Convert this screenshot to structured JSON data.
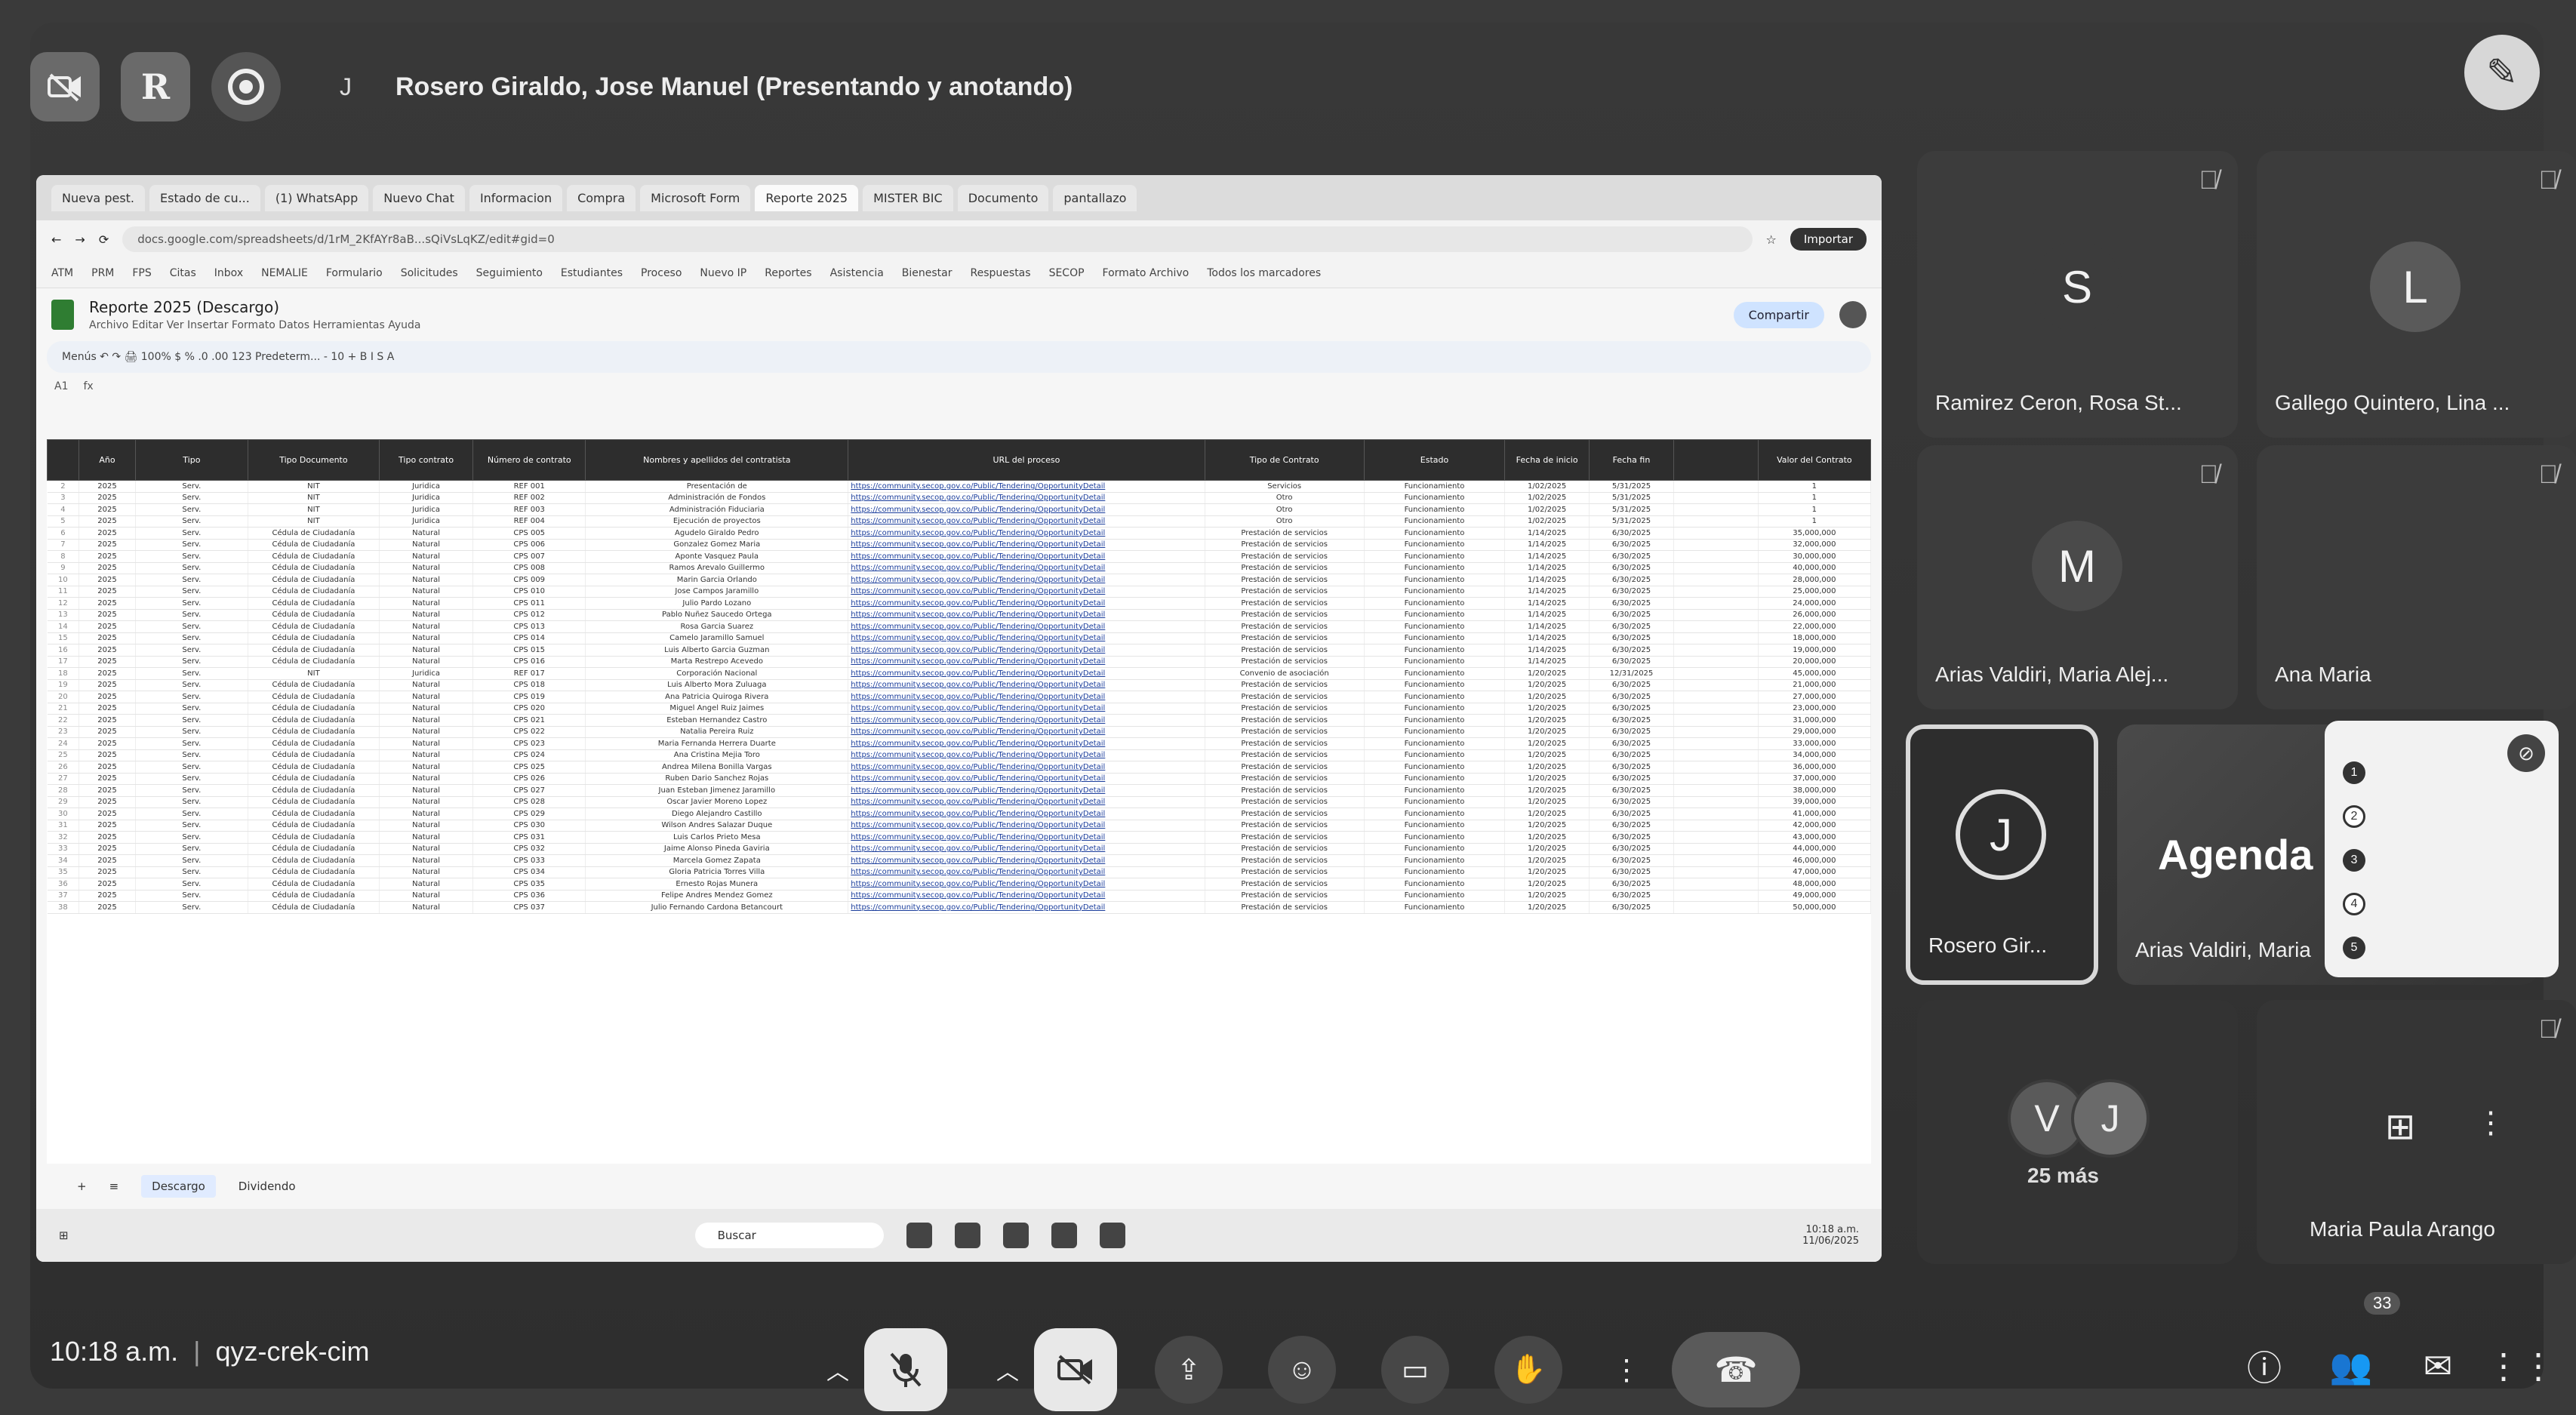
{
  "topbar": {
    "btn_noVideo_icon": "camera-off-icon",
    "btn_book_icon": "presentation-icon",
    "btn_record_icon": "record-icon",
    "presenter_initial": "J",
    "presenter_label": "Rosero Giraldo, Jose Manuel (Presentando y anotando)",
    "annotate_icon": "pencil-icon"
  },
  "screen": {
    "tabs": [
      "Nueva pest.",
      "Estado de cu...",
      "(1) WhatsApp",
      "Nuevo Chat",
      "Informacion",
      "Compra",
      "Microsoft Form",
      "Reporte 2025",
      "MISTER BIC",
      "Documento",
      "pantallazo"
    ],
    "url": "docs.google.com/spreadsheets/d/1rM_2KfAYr8aB...sQiVsLqKZ/edit#gid=0",
    "import_label": "Importar",
    "bookmarks": [
      "ATM",
      "PRM",
      "FPS",
      "Citas",
      "Inbox",
      "NEMALIE",
      "Formulario",
      "Solicitudes",
      "Seguimiento",
      "Estudiantes",
      "Proceso",
      "Nuevo IP",
      "Reportes",
      "Asistencia",
      "Bienestar",
      "Respuestas",
      "SECOP",
      "Formato Archivo",
      "Todos los marcadores"
    ],
    "doc_title": "Reporte 2025 (Descargo)",
    "doc_menu": "Archivo   Editar   Ver   Insertar   Formato   Datos   Herramientas   Ayuda",
    "share_label": "Compartir",
    "toolbar_text": "Menús   ↶  ↷  🖨  100%  $  %  .0  .00  123  Predeterm...  -  10  +  B  I  S  A",
    "cell_ref": "A1",
    "headers": [
      "Año",
      "Tipo",
      "Tipo Documento",
      "Tipo contrato",
      "Número de contrato",
      "Nombres y apellidos del contratista",
      "URL del proceso",
      "Tipo de Contrato",
      "Estado",
      "Fecha de inicio",
      "Fecha fin",
      "",
      "Valor del Contrato"
    ],
    "rows": [
      [
        "2025",
        "Serv.",
        "NIT",
        "Juridica",
        "REF 001",
        "Presentación de",
        "https://community.secop.gov.co/Public/Tendering/OpportunityDetail",
        "Servicios",
        "Funcionamiento",
        "1/02/2025",
        "5/31/2025",
        "",
        "1"
      ],
      [
        "2025",
        "Serv.",
        "NIT",
        "Juridica",
        "REF 002",
        "Administración de Fondos",
        "https://community.secop.gov.co/Public/Tendering/OpportunityDetail",
        "Otro",
        "Funcionamiento",
        "1/02/2025",
        "5/31/2025",
        "",
        "1"
      ],
      [
        "2025",
        "Serv.",
        "NIT",
        "Juridica",
        "REF 003",
        "Administración Fiduciaria",
        "https://community.secop.gov.co/Public/Tendering/OpportunityDetail",
        "Otro",
        "Funcionamiento",
        "1/02/2025",
        "5/31/2025",
        "",
        "1"
      ],
      [
        "2025",
        "Serv.",
        "NIT",
        "Juridica",
        "REF 004",
        "Ejecución de proyectos",
        "https://community.secop.gov.co/Public/Tendering/OpportunityDetail",
        "Otro",
        "Funcionamiento",
        "1/02/2025",
        "5/31/2025",
        "",
        "1"
      ],
      [
        "2025",
        "Serv.",
        "Cédula de Ciudadanía",
        "Natural",
        "CPS 005",
        "Agudelo Giraldo Pedro",
        "https://community.secop.gov.co/Public/Tendering/OpportunityDetail",
        "Prestación de servicios",
        "Funcionamiento",
        "1/14/2025",
        "6/30/2025",
        "",
        "35,000,000"
      ],
      [
        "2025",
        "Serv.",
        "Cédula de Ciudadanía",
        "Natural",
        "CPS 006",
        "Gonzalez Gomez Maria",
        "https://community.secop.gov.co/Public/Tendering/OpportunityDetail",
        "Prestación de servicios",
        "Funcionamiento",
        "1/14/2025",
        "6/30/2025",
        "",
        "32,000,000"
      ],
      [
        "2025",
        "Serv.",
        "Cédula de Ciudadanía",
        "Natural",
        "CPS 007",
        "Aponte Vasquez Paula",
        "https://community.secop.gov.co/Public/Tendering/OpportunityDetail",
        "Prestación de servicios",
        "Funcionamiento",
        "1/14/2025",
        "6/30/2025",
        "",
        "30,000,000"
      ],
      [
        "2025",
        "Serv.",
        "Cédula de Ciudadanía",
        "Natural",
        "CPS 008",
        "Ramos Arevalo Guillermo",
        "https://community.secop.gov.co/Public/Tendering/OpportunityDetail",
        "Prestación de servicios",
        "Funcionamiento",
        "1/14/2025",
        "6/30/2025",
        "",
        "40,000,000"
      ],
      [
        "2025",
        "Serv.",
        "Cédula de Ciudadanía",
        "Natural",
        "CPS 009",
        "Marin Garcia Orlando",
        "https://community.secop.gov.co/Public/Tendering/OpportunityDetail",
        "Prestación de servicios",
        "Funcionamiento",
        "1/14/2025",
        "6/30/2025",
        "",
        "28,000,000"
      ],
      [
        "2025",
        "Serv.",
        "Cédula de Ciudadanía",
        "Natural",
        "CPS 010",
        "Jose Campos Jaramillo",
        "https://community.secop.gov.co/Public/Tendering/OpportunityDetail",
        "Prestación de servicios",
        "Funcionamiento",
        "1/14/2025",
        "6/30/2025",
        "",
        "25,000,000"
      ],
      [
        "2025",
        "Serv.",
        "Cédula de Ciudadanía",
        "Natural",
        "CPS 011",
        "Julio Pardo Lozano",
        "https://community.secop.gov.co/Public/Tendering/OpportunityDetail",
        "Prestación de servicios",
        "Funcionamiento",
        "1/14/2025",
        "6/30/2025",
        "",
        "24,000,000"
      ],
      [
        "2025",
        "Serv.",
        "Cédula de Ciudadanía",
        "Natural",
        "CPS 012",
        "Pablo Nuñez Saucedo Ortega",
        "https://community.secop.gov.co/Public/Tendering/OpportunityDetail",
        "Prestación de servicios",
        "Funcionamiento",
        "1/14/2025",
        "6/30/2025",
        "",
        "26,000,000"
      ],
      [
        "2025",
        "Serv.",
        "Cédula de Ciudadanía",
        "Natural",
        "CPS 013",
        "Rosa Garcia Suarez",
        "https://community.secop.gov.co/Public/Tendering/OpportunityDetail",
        "Prestación de servicios",
        "Funcionamiento",
        "1/14/2025",
        "6/30/2025",
        "",
        "22,000,000"
      ],
      [
        "2025",
        "Serv.",
        "Cédula de Ciudadanía",
        "Natural",
        "CPS 014",
        "Camelo Jaramillo Samuel",
        "https://community.secop.gov.co/Public/Tendering/OpportunityDetail",
        "Prestación de servicios",
        "Funcionamiento",
        "1/14/2025",
        "6/30/2025",
        "",
        "18,000,000"
      ],
      [
        "2025",
        "Serv.",
        "Cédula de Ciudadanía",
        "Natural",
        "CPS 015",
        "Luis Alberto Garcia Guzman",
        "https://community.secop.gov.co/Public/Tendering/OpportunityDetail",
        "Prestación de servicios",
        "Funcionamiento",
        "1/14/2025",
        "6/30/2025",
        "",
        "19,000,000"
      ],
      [
        "2025",
        "Serv.",
        "Cédula de Ciudadanía",
        "Natural",
        "CPS 016",
        "Marta Restrepo Acevedo",
        "https://community.secop.gov.co/Public/Tendering/OpportunityDetail",
        "Prestación de servicios",
        "Funcionamiento",
        "1/14/2025",
        "6/30/2025",
        "",
        "20,000,000"
      ],
      [
        "2025",
        "Serv.",
        "NIT",
        "Juridica",
        "REF 017",
        "Corporación Nacional",
        "https://community.secop.gov.co/Public/Tendering/OpportunityDetail",
        "Convenio de asociación",
        "Funcionamiento",
        "1/20/2025",
        "12/31/2025",
        "",
        "45,000,000"
      ],
      [
        "2025",
        "Serv.",
        "Cédula de Ciudadanía",
        "Natural",
        "CPS 018",
        "Luis Alberto Mora Zuluaga",
        "https://community.secop.gov.co/Public/Tendering/OpportunityDetail",
        "Prestación de servicios",
        "Funcionamiento",
        "1/20/2025",
        "6/30/2025",
        "",
        "21,000,000"
      ],
      [
        "2025",
        "Serv.",
        "Cédula de Ciudadanía",
        "Natural",
        "CPS 019",
        "Ana Patricia Quiroga Rivera",
        "https://community.secop.gov.co/Public/Tendering/OpportunityDetail",
        "Prestación de servicios",
        "Funcionamiento",
        "1/20/2025",
        "6/30/2025",
        "",
        "27,000,000"
      ],
      [
        "2025",
        "Serv.",
        "Cédula de Ciudadanía",
        "Natural",
        "CPS 020",
        "Miguel Angel Ruiz Jaimes",
        "https://community.secop.gov.co/Public/Tendering/OpportunityDetail",
        "Prestación de servicios",
        "Funcionamiento",
        "1/20/2025",
        "6/30/2025",
        "",
        "23,000,000"
      ],
      [
        "2025",
        "Serv.",
        "Cédula de Ciudadanía",
        "Natural",
        "CPS 021",
        "Esteban Hernandez Castro",
        "https://community.secop.gov.co/Public/Tendering/OpportunityDetail",
        "Prestación de servicios",
        "Funcionamiento",
        "1/20/2025",
        "6/30/2025",
        "",
        "31,000,000"
      ],
      [
        "2025",
        "Serv.",
        "Cédula de Ciudadanía",
        "Natural",
        "CPS 022",
        "Natalia Pereira Ruiz",
        "https://community.secop.gov.co/Public/Tendering/OpportunityDetail",
        "Prestación de servicios",
        "Funcionamiento",
        "1/20/2025",
        "6/30/2025",
        "",
        "29,000,000"
      ],
      [
        "2025",
        "Serv.",
        "Cédula de Ciudadanía",
        "Natural",
        "CPS 023",
        "Maria Fernanda Herrera Duarte",
        "https://community.secop.gov.co/Public/Tendering/OpportunityDetail",
        "Prestación de servicios",
        "Funcionamiento",
        "1/20/2025",
        "6/30/2025",
        "",
        "33,000,000"
      ],
      [
        "2025",
        "Serv.",
        "Cédula de Ciudadanía",
        "Natural",
        "CPS 024",
        "Ana Cristina Mejia Toro",
        "https://community.secop.gov.co/Public/Tendering/OpportunityDetail",
        "Prestación de servicios",
        "Funcionamiento",
        "1/20/2025",
        "6/30/2025",
        "",
        "34,000,000"
      ],
      [
        "2025",
        "Serv.",
        "Cédula de Ciudadanía",
        "Natural",
        "CPS 025",
        "Andrea Milena Bonilla Vargas",
        "https://community.secop.gov.co/Public/Tendering/OpportunityDetail",
        "Prestación de servicios",
        "Funcionamiento",
        "1/20/2025",
        "6/30/2025",
        "",
        "36,000,000"
      ],
      [
        "2025",
        "Serv.",
        "Cédula de Ciudadanía",
        "Natural",
        "CPS 026",
        "Ruben Dario Sanchez Rojas",
        "https://community.secop.gov.co/Public/Tendering/OpportunityDetail",
        "Prestación de servicios",
        "Funcionamiento",
        "1/20/2025",
        "6/30/2025",
        "",
        "37,000,000"
      ],
      [
        "2025",
        "Serv.",
        "Cédula de Ciudadanía",
        "Natural",
        "CPS 027",
        "Juan Esteban Jimenez Jaramillo",
        "https://community.secop.gov.co/Public/Tendering/OpportunityDetail",
        "Prestación de servicios",
        "Funcionamiento",
        "1/20/2025",
        "6/30/2025",
        "",
        "38,000,000"
      ],
      [
        "2025",
        "Serv.",
        "Cédula de Ciudadanía",
        "Natural",
        "CPS 028",
        "Oscar Javier Moreno Lopez",
        "https://community.secop.gov.co/Public/Tendering/OpportunityDetail",
        "Prestación de servicios",
        "Funcionamiento",
        "1/20/2025",
        "6/30/2025",
        "",
        "39,000,000"
      ],
      [
        "2025",
        "Serv.",
        "Cédula de Ciudadanía",
        "Natural",
        "CPS 029",
        "Diego Alejandro Castillo",
        "https://community.secop.gov.co/Public/Tendering/OpportunityDetail",
        "Prestación de servicios",
        "Funcionamiento",
        "1/20/2025",
        "6/30/2025",
        "",
        "41,000,000"
      ],
      [
        "2025",
        "Serv.",
        "Cédula de Ciudadanía",
        "Natural",
        "CPS 030",
        "Wilson Andres Salazar Duque",
        "https://community.secop.gov.co/Public/Tendering/OpportunityDetail",
        "Prestación de servicios",
        "Funcionamiento",
        "1/20/2025",
        "6/30/2025",
        "",
        "42,000,000"
      ],
      [
        "2025",
        "Serv.",
        "Cédula de Ciudadanía",
        "Natural",
        "CPS 031",
        "Luis Carlos Prieto Mesa",
        "https://community.secop.gov.co/Public/Tendering/OpportunityDetail",
        "Prestación de servicios",
        "Funcionamiento",
        "1/20/2025",
        "6/30/2025",
        "",
        "43,000,000"
      ],
      [
        "2025",
        "Serv.",
        "Cédula de Ciudadanía",
        "Natural",
        "CPS 032",
        "Jaime Alonso Pineda Gaviria",
        "https://community.secop.gov.co/Public/Tendering/OpportunityDetail",
        "Prestación de servicios",
        "Funcionamiento",
        "1/20/2025",
        "6/30/2025",
        "",
        "44,000,000"
      ],
      [
        "2025",
        "Serv.",
        "Cédula de Ciudadanía",
        "Natural",
        "CPS 033",
        "Marcela Gomez Zapata",
        "https://community.secop.gov.co/Public/Tendering/OpportunityDetail",
        "Prestación de servicios",
        "Funcionamiento",
        "1/20/2025",
        "6/30/2025",
        "",
        "46,000,000"
      ],
      [
        "2025",
        "Serv.",
        "Cédula de Ciudadanía",
        "Natural",
        "CPS 034",
        "Gloria Patricia Torres Villa",
        "https://community.secop.gov.co/Public/Tendering/OpportunityDetail",
        "Prestación de servicios",
        "Funcionamiento",
        "1/20/2025",
        "6/30/2025",
        "",
        "47,000,000"
      ],
      [
        "2025",
        "Serv.",
        "Cédula de Ciudadanía",
        "Natural",
        "CPS 035",
        "Ernesto Rojas Munera",
        "https://community.secop.gov.co/Public/Tendering/OpportunityDetail",
        "Prestación de servicios",
        "Funcionamiento",
        "1/20/2025",
        "6/30/2025",
        "",
        "48,000,000"
      ],
      [
        "2025",
        "Serv.",
        "Cédula de Ciudadanía",
        "Natural",
        "CPS 036",
        "Felipe Andres Mendez Gomez",
        "https://community.secop.gov.co/Public/Tendering/OpportunityDetail",
        "Prestación de servicios",
        "Funcionamiento",
        "1/20/2025",
        "6/30/2025",
        "",
        "49,000,000"
      ],
      [
        "2025",
        "Serv.",
        "Cédula de Ciudadanía",
        "Natural",
        "CPS 037",
        "Julio Fernando Cardona Betancourt",
        "https://community.secop.gov.co/Public/Tendering/OpportunityDetail",
        "Prestación de servicios",
        "Funcionamiento",
        "1/20/2025",
        "6/30/2025",
        "",
        "50,000,000"
      ]
    ],
    "sheet_tabs": [
      "Descargo",
      "Dividendo"
    ],
    "taskbar_search": "Buscar",
    "taskbar_time": "10:18 a.m.",
    "taskbar_date": "11/06/2025"
  },
  "participants": [
    {
      "initial": "S",
      "name": "Ramirez Ceron, Rosa St...",
      "color": "#3c3c3c"
    },
    {
      "initial": "L",
      "name": "Gallego Quintero, Lina ...",
      "color": "#5a5a5a"
    },
    {
      "initial": "M",
      "name": "Arias Valdiri, Maria Alej...",
      "color": "#4a4a4a"
    },
    {
      "initial": "",
      "name": "Ana Maria",
      "color": ""
    },
    {
      "initial": "J",
      "name": "Rosero Gir...",
      "color": ""
    },
    {
      "initial": "",
      "name": "Arias Valdiri, Maria",
      "color": ""
    },
    {
      "initial": "",
      "name": "Maria Paula Arango",
      "color": ""
    }
  ],
  "agenda_text": "Agenda",
  "popup_menu": {
    "items": [
      "1",
      "2",
      "3",
      "4",
      "5"
    ]
  },
  "more": {
    "initials": [
      "V",
      "J"
    ],
    "label": "25 más"
  },
  "bottom": {
    "time": "10:18 a.m.",
    "code": "qyz-crek-cim",
    "participant_count": "33"
  },
  "icons": {
    "mic_off": "mic-off-icon",
    "cam_off": "camera-off-icon",
    "present": "present-icon",
    "emoji": "emoji-icon",
    "captions": "captions-icon",
    "hand": "raise-hand-icon",
    "more": "more-vert-icon",
    "hangup": "hang-up-icon",
    "info": "info-icon",
    "people": "people-icon",
    "chat": "chat-icon",
    "apps": "apps-icon"
  }
}
